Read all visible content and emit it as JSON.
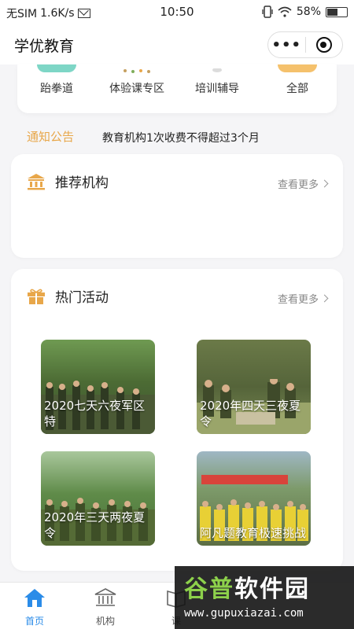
{
  "status_bar": {
    "carrier": "无SIM",
    "speed": "1.6K/s",
    "time": "10:50",
    "battery": "58%",
    "battery_level": 0.58
  },
  "title_bar": {
    "title": "学优教育",
    "more_label": "•••"
  },
  "categories": [
    {
      "label": "跆拳道",
      "icon": "taekwondo-icon",
      "color": "#7ed6c6"
    },
    {
      "label": "体验课专区",
      "icon": "experience-icon",
      "color": "#f2d9a6"
    },
    {
      "label": "培训辅导",
      "icon": "training-icon",
      "color": "#e4e4e4"
    },
    {
      "label": "全部",
      "icon": "all-icon",
      "color": "#f5c16c"
    }
  ],
  "notice": {
    "tag": "通知公告",
    "text": "教育机构1次收费不得超过3个月"
  },
  "recommended": {
    "title": "推荐机构",
    "more": "查看更多",
    "icon": "institution-icon"
  },
  "hot_activities": {
    "title": "热门活动",
    "more": "查看更多",
    "icon": "gift-icon",
    "items": [
      {
        "caption": "2020七天六夜军区特"
      },
      {
        "caption": "2020年四天三夜夏令"
      },
      {
        "caption": "2020年三天两夜夏令"
      },
      {
        "caption": "阿凡题教育极速挑战"
      }
    ]
  },
  "tabbar": {
    "home": "首页",
    "institution": "机构",
    "course": "课"
  },
  "watermark": {
    "title_a": "谷普",
    "title_b": "软件园",
    "url": "www.gupuxiazai.com"
  }
}
